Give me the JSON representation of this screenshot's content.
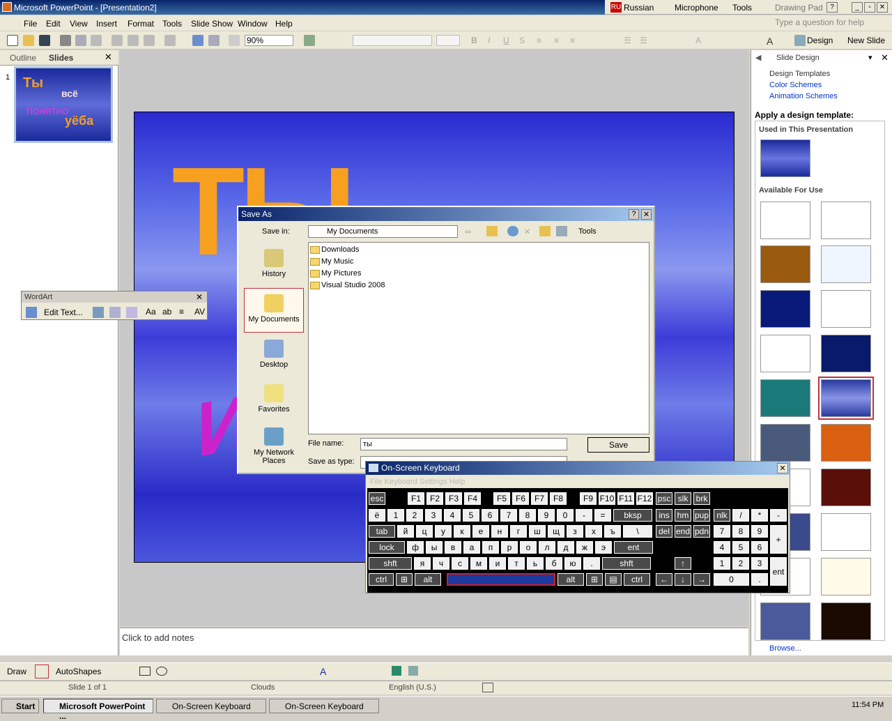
{
  "window": {
    "title": "Microsoft PowerPoint - [Presentation2]"
  },
  "langbar": {
    "lang": "Russian",
    "microphone": "Microphone",
    "tools": "Tools",
    "drawing_pad": "Drawing Pad"
  },
  "menu": [
    "File",
    "Edit",
    "View",
    "Insert",
    "Format",
    "Tools",
    "Slide Show",
    "Window",
    "Help"
  ],
  "help_placeholder": "Type a question for help",
  "toolbar": {
    "zoom": "90%",
    "design": "Design",
    "new_slide": "New Slide"
  },
  "left_tabs": {
    "outline": "Outline",
    "slides": "Slides",
    "slide_num": "1"
  },
  "thumb_words": [
    "Ты",
    "всё",
    "ПОНЯТНО",
    "уёба"
  ],
  "slide": {
    "big_text": "ТЫ",
    "side_text": "ИС"
  },
  "notes": "Click to add notes",
  "task_pane": {
    "title": "Slide Design",
    "links": [
      "Design Templates",
      "Color Schemes",
      "Animation Schemes"
    ],
    "apply": "Apply a design template:",
    "used": "Used in This Presentation",
    "available": "Available For Use",
    "browse": "Browse..."
  },
  "wordart": {
    "title": "WordArt",
    "edit": "Edit Text..."
  },
  "save_dialog": {
    "title": "Save As",
    "save_in_label": "Save in:",
    "save_in": "My Documents",
    "tools": "Tools",
    "places": [
      "History",
      "My Documents",
      "Desktop",
      "Favorites",
      "My Network Places"
    ],
    "files": [
      "Downloads",
      "My Music",
      "My Pictures",
      "Visual Studio 2008"
    ],
    "file_name_label": "File name:",
    "file_name": "ты",
    "save_type_label": "Save as type:",
    "save_btn": "Save"
  },
  "osk": {
    "title": "On-Screen Keyboard",
    "menu": "File  Keyboard  Settings  Help"
  },
  "drawbar": {
    "draw": "Draw",
    "autoshapes": "AutoShapes"
  },
  "status": {
    "slide": "Slide 1 of 1",
    "design": "Clouds",
    "lang": "English (U.S.)"
  },
  "taskbar": {
    "start": "Start",
    "tasks": [
      "Microsoft PowerPoint ...",
      "On-Screen Keyboard",
      "On-Screen Keyboard"
    ],
    "clock": "11:54 PM"
  },
  "colors": {
    "title": "#0a246a",
    "slide_bg": "#3c3cd8",
    "accent": "#f7a020",
    "selected": "#c03040"
  }
}
